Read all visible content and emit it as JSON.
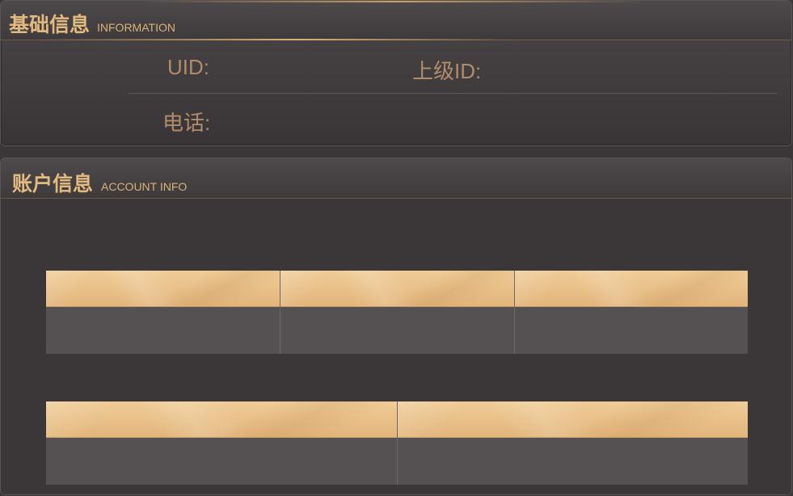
{
  "basic_info": {
    "title": "基础信息",
    "subtitle": "INFORMATION",
    "fields": {
      "uid_label": "UID:",
      "parent_id_label": "上级ID:",
      "phone_label": "电话:"
    }
  },
  "account_info": {
    "title": "账户信息",
    "subtitle": "ACCOUNT INFO",
    "row1_cards": 3,
    "row2_cards": 2
  },
  "colors": {
    "accent_gold": "#e2b97f",
    "label_bronze": "#b08c6b",
    "panel_bg": "#403b3c",
    "card_body": "#555152"
  }
}
